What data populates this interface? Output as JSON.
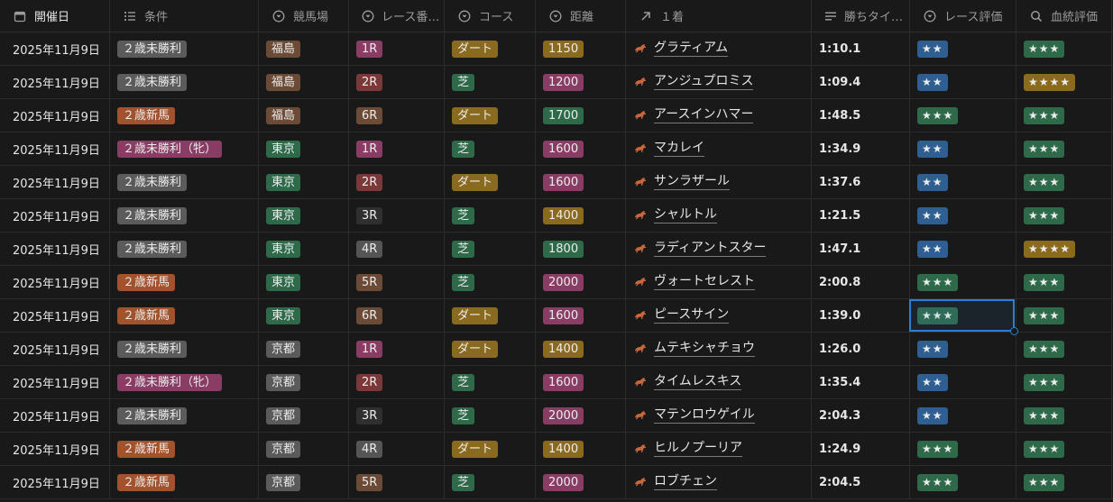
{
  "columns": [
    {
      "key": "date",
      "label": "開催日",
      "icon": "calendar-icon"
    },
    {
      "key": "condition",
      "label": "条件",
      "icon": "list-icon"
    },
    {
      "key": "track",
      "label": "競馬場",
      "icon": "select-icon"
    },
    {
      "key": "race",
      "label": "レース番…",
      "icon": "select-icon"
    },
    {
      "key": "course",
      "label": "コース",
      "icon": "select-icon"
    },
    {
      "key": "distance",
      "label": "距離",
      "icon": "select-icon"
    },
    {
      "key": "winner",
      "label": "１着",
      "icon": "arrow-up-right-icon"
    },
    {
      "key": "time",
      "label": "勝ちタイ…",
      "icon": "text-lines-icon"
    },
    {
      "key": "race_eval",
      "label": "レース評価",
      "icon": "select-icon"
    },
    {
      "key": "blood_eval",
      "label": "血統評価",
      "icon": "search-icon"
    }
  ],
  "colors": {
    "condition": {
      "２歳未勝利": "#5b5b5b",
      "２歳新馬": "#a0532c",
      "２歳未勝利（牝）": "#8a3d64"
    },
    "track": {
      "福島": "#6b4a36",
      "東京": "#2e6a4a",
      "京都": "#5a5a5a"
    },
    "race": {
      "1R": "#8a3d64",
      "2R": "#7a3838",
      "3R": "#2f2f2f",
      "4R": "#555555",
      "5R": "#6b4a36",
      "6R": "#6b4a36"
    },
    "course": {
      "ダート": "#8a6a1e",
      "芝": "#2e6a4a"
    },
    "distance": {
      "1150": "#8a6a1e",
      "1200": "#8a3d64",
      "1400": "#8a6a1e",
      "1600": "#8a3d64",
      "1700": "#2e6a4a",
      "1800": "#2e6a4a",
      "2000": "#8a3d64"
    },
    "stars": {
      "★★": "#2f5f91",
      "★★★": "#2e6a4a",
      "★★★★": "#8a6a1e"
    },
    "selection": "#2e7fd0"
  },
  "rows": [
    {
      "date": "2025年11月9日",
      "condition": "２歳未勝利",
      "track": "福島",
      "race": "1R",
      "course": "ダート",
      "distance": "1150",
      "winner": "グラティアム",
      "time": "1:10.1",
      "race_eval": "★★",
      "blood_eval": "★★★"
    },
    {
      "date": "2025年11月9日",
      "condition": "２歳未勝利",
      "track": "福島",
      "race": "2R",
      "course": "芝",
      "distance": "1200",
      "winner": "アンジュプロミス",
      "time": "1:09.4",
      "race_eval": "★★",
      "blood_eval": "★★★★"
    },
    {
      "date": "2025年11月9日",
      "condition": "２歳新馬",
      "track": "福島",
      "race": "6R",
      "course": "ダート",
      "distance": "1700",
      "winner": "アースインハマー",
      "time": "1:48.5",
      "race_eval": "★★★",
      "blood_eval": "★★★"
    },
    {
      "date": "2025年11月9日",
      "condition": "２歳未勝利（牝）",
      "track": "東京",
      "race": "1R",
      "course": "芝",
      "distance": "1600",
      "winner": "マカレイ",
      "time": "1:34.9",
      "race_eval": "★★",
      "blood_eval": "★★★"
    },
    {
      "date": "2025年11月9日",
      "condition": "２歳未勝利",
      "track": "東京",
      "race": "2R",
      "course": "ダート",
      "distance": "1600",
      "winner": "サンラザール",
      "time": "1:37.6",
      "race_eval": "★★",
      "blood_eval": "★★★"
    },
    {
      "date": "2025年11月9日",
      "condition": "２歳未勝利",
      "track": "東京",
      "race": "3R",
      "course": "芝",
      "distance": "1400",
      "winner": "シャルトル",
      "time": "1:21.5",
      "race_eval": "★★",
      "blood_eval": "★★★"
    },
    {
      "date": "2025年11月9日",
      "condition": "２歳未勝利",
      "track": "東京",
      "race": "4R",
      "course": "芝",
      "distance": "1800",
      "winner": "ラディアントスター",
      "time": "1:47.1",
      "race_eval": "★★",
      "blood_eval": "★★★★"
    },
    {
      "date": "2025年11月9日",
      "condition": "２歳新馬",
      "track": "東京",
      "race": "5R",
      "course": "芝",
      "distance": "2000",
      "winner": "ヴォートセレスト",
      "time": "2:00.8",
      "race_eval": "★★★",
      "blood_eval": "★★★"
    },
    {
      "date": "2025年11月9日",
      "condition": "２歳新馬",
      "track": "東京",
      "race": "6R",
      "course": "ダート",
      "distance": "1600",
      "winner": "ピースサイン",
      "time": "1:39.0",
      "race_eval": "★★★",
      "blood_eval": "★★★"
    },
    {
      "date": "2025年11月9日",
      "condition": "２歳未勝利",
      "track": "京都",
      "race": "1R",
      "course": "ダート",
      "distance": "1400",
      "winner": "ムテキシャチョウ",
      "time": "1:26.0",
      "race_eval": "★★",
      "blood_eval": "★★★"
    },
    {
      "date": "2025年11月9日",
      "condition": "２歳未勝利（牝）",
      "track": "京都",
      "race": "2R",
      "course": "芝",
      "distance": "1600",
      "winner": "タイムレスキス",
      "time": "1:35.4",
      "race_eval": "★★",
      "blood_eval": "★★★"
    },
    {
      "date": "2025年11月9日",
      "condition": "２歳未勝利",
      "track": "京都",
      "race": "3R",
      "course": "芝",
      "distance": "2000",
      "winner": "マテンロウゲイル",
      "time": "2:04.3",
      "race_eval": "★★",
      "blood_eval": "★★★"
    },
    {
      "date": "2025年11月9日",
      "condition": "２歳新馬",
      "track": "京都",
      "race": "4R",
      "course": "ダート",
      "distance": "1400",
      "winner": "ヒルノプーリア",
      "time": "1:24.9",
      "race_eval": "★★★",
      "blood_eval": "★★★"
    },
    {
      "date": "2025年11月9日",
      "condition": "２歳新馬",
      "track": "京都",
      "race": "5R",
      "course": "芝",
      "distance": "2000",
      "winner": "ロブチェン",
      "time": "2:04.5",
      "race_eval": "★★★",
      "blood_eval": "★★★"
    }
  ]
}
